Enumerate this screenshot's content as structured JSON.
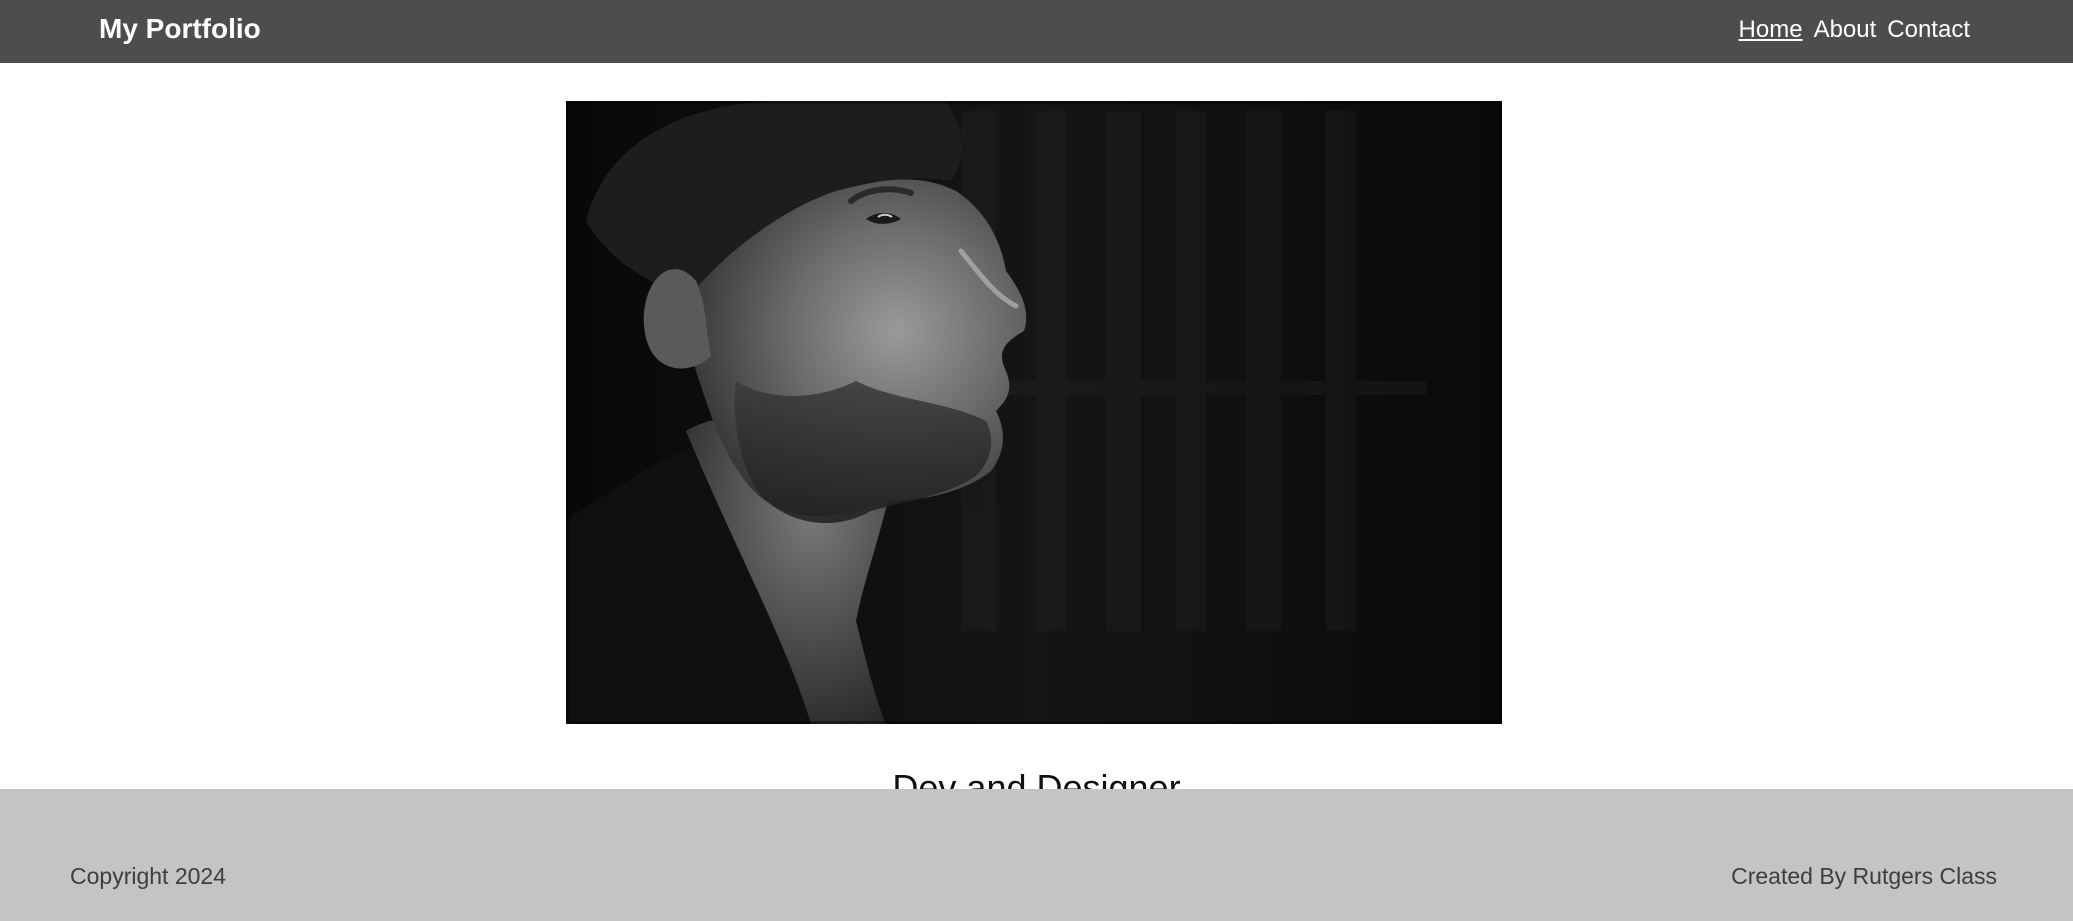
{
  "header": {
    "brand": "My Portfolio",
    "nav": [
      {
        "label": "Home",
        "active": true
      },
      {
        "label": "About",
        "active": false
      },
      {
        "label": "Contact",
        "active": false
      }
    ]
  },
  "hero": {
    "image": "portrait-photo"
  },
  "main": {
    "tagline": "Dev and Designer"
  },
  "footer": {
    "copyright": "Copyright 2024",
    "credit": "Created By Rutgers Class"
  },
  "colors": {
    "navbar_bg": "#4d4d4d",
    "footer_bg": "#c4c4c4",
    "page_bg": "#ffffff"
  }
}
